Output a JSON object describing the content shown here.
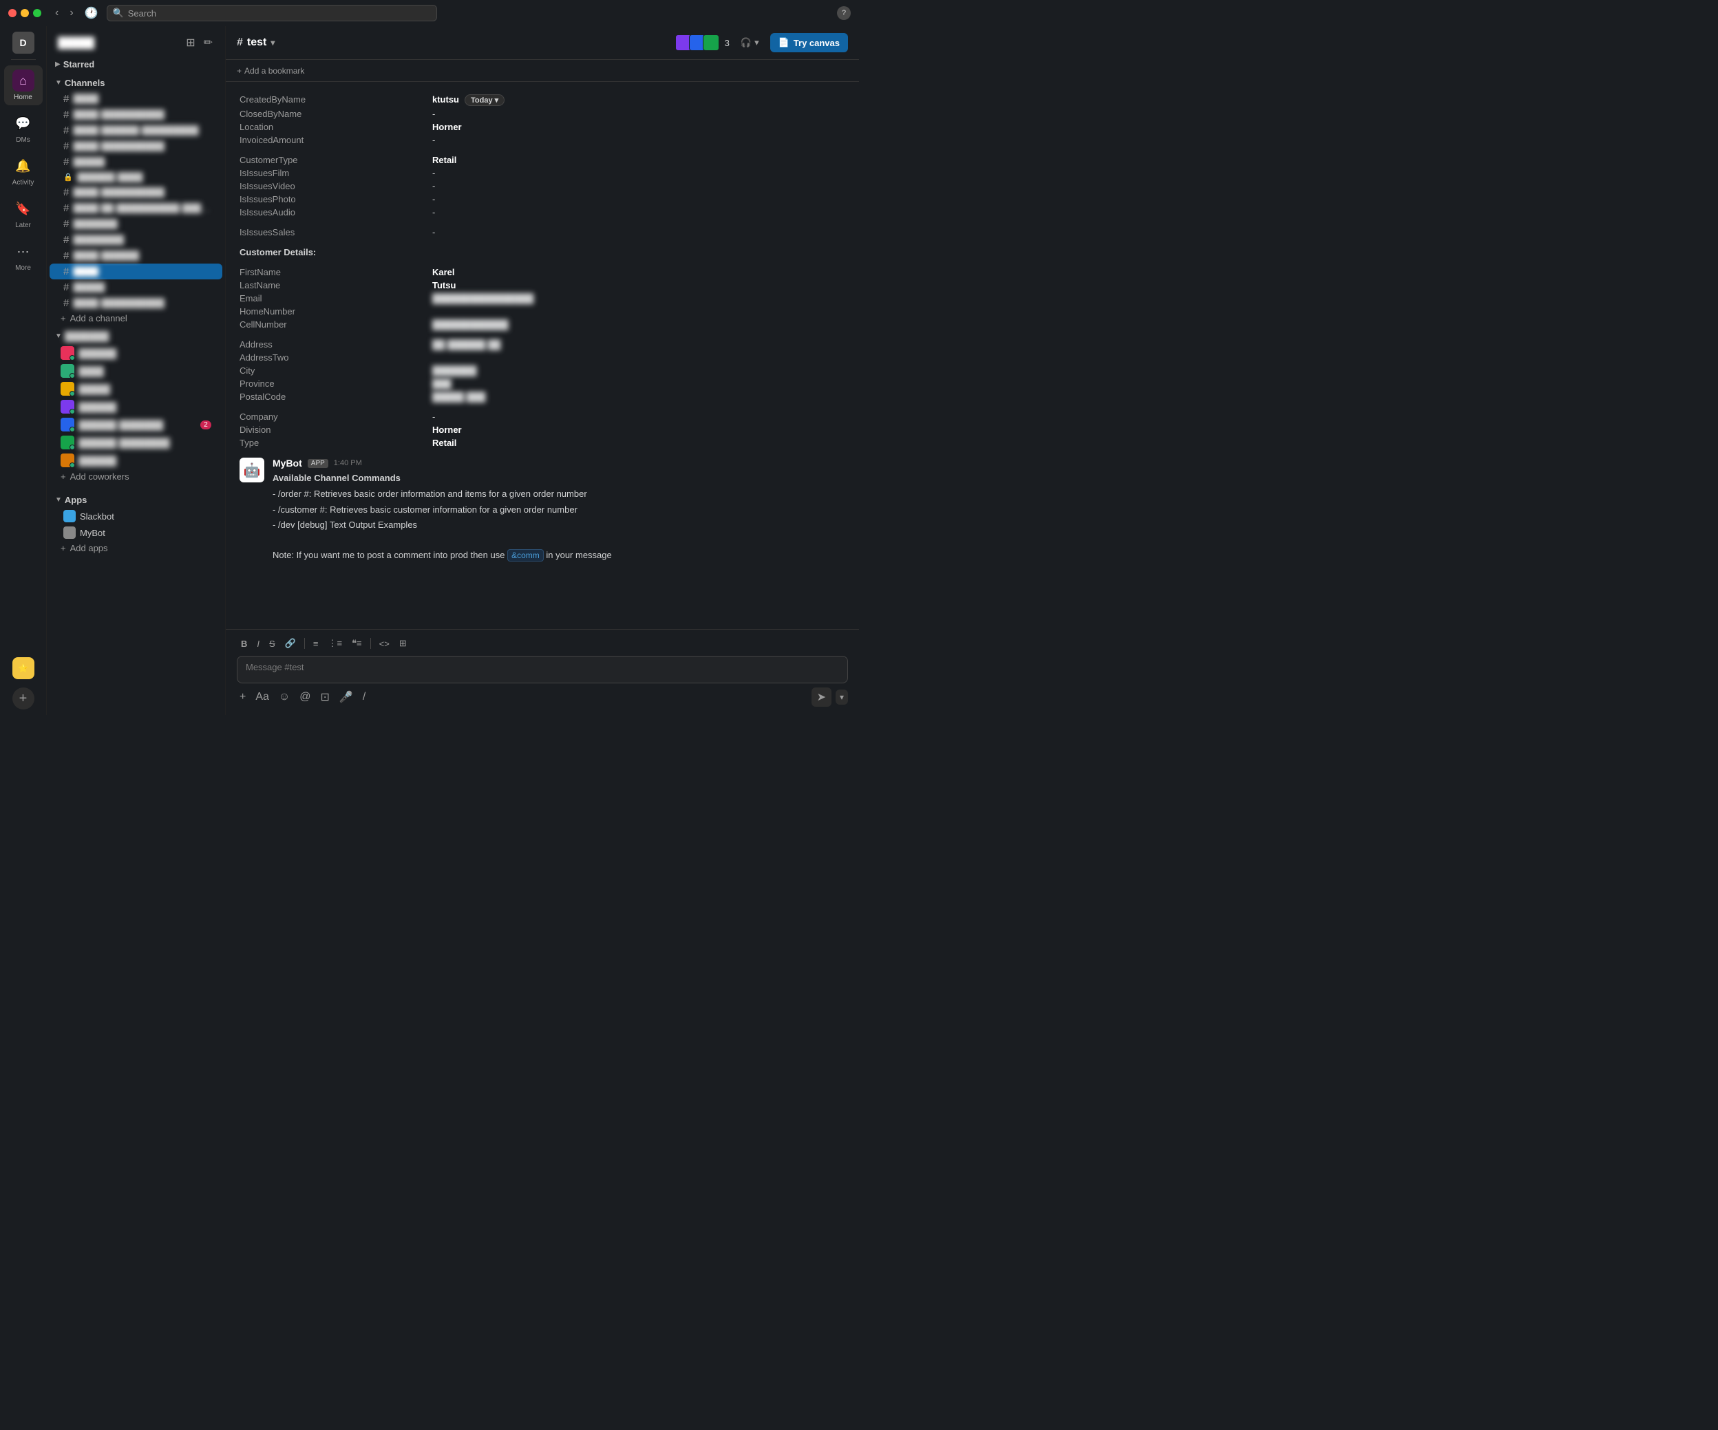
{
  "titlebar": {
    "search_placeholder": "Search"
  },
  "rail": {
    "avatar_initial": "D",
    "home_label": "Home",
    "dms_label": "DMs",
    "activity_label": "Activity",
    "later_label": "Later",
    "more_label": "More"
  },
  "sidebar": {
    "workspace_name": "█████",
    "starred_label": "Starred",
    "channels_label": "Channels",
    "channels": [
      {
        "name": "████",
        "active": false
      },
      {
        "name": "████ ██████████",
        "active": false
      },
      {
        "name": "████ ██████ █████████",
        "active": false
      },
      {
        "name": "████ ██████████",
        "active": false
      },
      {
        "name": "█████",
        "active": false
      },
      {
        "name": "██████ ████",
        "active": false
      },
      {
        "name": "████ ██████████",
        "active": false
      },
      {
        "name": "████ ██ ██████████ ██████",
        "active": false
      },
      {
        "name": "███████",
        "active": false
      },
      {
        "name": "████████",
        "active": false
      },
      {
        "name": "████ ██████",
        "active": false
      },
      {
        "name": "████",
        "active": true
      },
      {
        "name": "█████",
        "active": false
      },
      {
        "name": "████ ██████████",
        "active": false
      }
    ],
    "add_channel_label": "Add a channel",
    "dms_section_label": "███████",
    "dm_users": [
      {
        "name": "██████",
        "badge": ""
      },
      {
        "name": "████",
        "badge": ""
      },
      {
        "name": "█████",
        "badge": ""
      },
      {
        "name": "██████",
        "badge": ""
      },
      {
        "name": "██████ ███████",
        "badge": "2"
      },
      {
        "name": "██████ ████████",
        "badge": ""
      },
      {
        "name": "██████",
        "badge": ""
      }
    ],
    "add_coworkers_label": "Add coworkers",
    "apps_label": "Apps",
    "apps": [
      {
        "name": "Slackbot",
        "color": "#3aa3e3"
      },
      {
        "name": "MyBot",
        "color": "#888"
      }
    ],
    "add_apps_label": "Add apps"
  },
  "channel": {
    "name": "test",
    "member_count": "3",
    "try_canvas_label": "Try canvas",
    "add_bookmark_label": "Add a bookmark"
  },
  "message": {
    "data_rows": [
      {
        "key": "CreatedByName",
        "value": "ktutsu",
        "bold": true,
        "blurred": false
      },
      {
        "key": "ClosedByName",
        "value": "-",
        "bold": false,
        "blurred": false
      },
      {
        "key": "Location",
        "value": "Horner",
        "bold": true,
        "blurred": false
      },
      {
        "key": "InvoicedAmount",
        "value": "-",
        "bold": false,
        "blurred": false
      },
      {
        "spacer": true
      },
      {
        "key": "CustomerType",
        "value": "Retail",
        "bold": true,
        "blurred": false
      },
      {
        "key": "IsIssuesFilm",
        "value": "-",
        "bold": false,
        "blurred": false
      },
      {
        "key": "IsIssuesVideo",
        "value": "-",
        "bold": false,
        "blurred": false
      },
      {
        "key": "IsIssuesPhoto",
        "value": "-",
        "bold": false,
        "blurred": false
      },
      {
        "key": "IsIssuesAudio",
        "value": "-",
        "bold": false,
        "blurred": false
      },
      {
        "spacer": true
      },
      {
        "key": "IsIssuesSales",
        "value": "-",
        "bold": false,
        "blurred": false
      },
      {
        "spacer": true
      },
      {
        "key": "Customer Details:",
        "value": "",
        "bold": false,
        "blurred": false,
        "header": true
      },
      {
        "spacer": true
      },
      {
        "key": "FirstName",
        "value": "Karel",
        "bold": true,
        "blurred": false
      },
      {
        "key": "LastName",
        "value": "Tutsu",
        "bold": true,
        "blurred": false
      },
      {
        "key": "Email",
        "value": "████████████████",
        "bold": false,
        "blurred": true
      },
      {
        "key": "HomeNumber",
        "value": "",
        "bold": false,
        "blurred": false
      },
      {
        "key": "CellNumber",
        "value": "████████████",
        "bold": false,
        "blurred": true
      },
      {
        "spacer": true
      },
      {
        "key": "Address",
        "value": "██ ██████ ██",
        "bold": false,
        "blurred": true
      },
      {
        "key": "AddressTwo",
        "value": "",
        "bold": false,
        "blurred": false
      },
      {
        "key": "City",
        "value": "███████",
        "bold": false,
        "blurred": true
      },
      {
        "key": "Province",
        "value": "███",
        "bold": false,
        "blurred": true
      },
      {
        "key": "PostalCode",
        "value": "█████ ███",
        "bold": false,
        "blurred": true
      },
      {
        "spacer": true
      },
      {
        "key": "Company",
        "value": "-",
        "bold": false,
        "blurred": false
      },
      {
        "key": "Division",
        "value": "Horner",
        "bold": true,
        "blurred": false
      },
      {
        "key": "Type",
        "value": "Retail",
        "bold": true,
        "blurred": false
      }
    ],
    "today_badge": "Today",
    "bot_name": "MyBot",
    "app_badge": "APP",
    "timestamp": "1:40 PM",
    "bot_lines": [
      "Available Channel Commands",
      "- /order #: Retrieves basic order information and items for a given order number",
      "- /customer #: Retrieves basic customer information for a given order number",
      "- /dev [debug] Text Output Examples",
      "",
      "Note: If you want me to post a comment into prod then use &comm in your message"
    ],
    "inline_link_text": "&comm"
  },
  "composer": {
    "placeholder": "Message #test",
    "toolbar_buttons": [
      "B",
      "I",
      "S",
      "🔗",
      "≡",
      "⁝≡",
      "⁰≡",
      "<>",
      "⊞"
    ],
    "footer_buttons": [
      "+",
      "Aa",
      "☺",
      "@",
      "⊡",
      "🎤",
      "⌀"
    ]
  }
}
